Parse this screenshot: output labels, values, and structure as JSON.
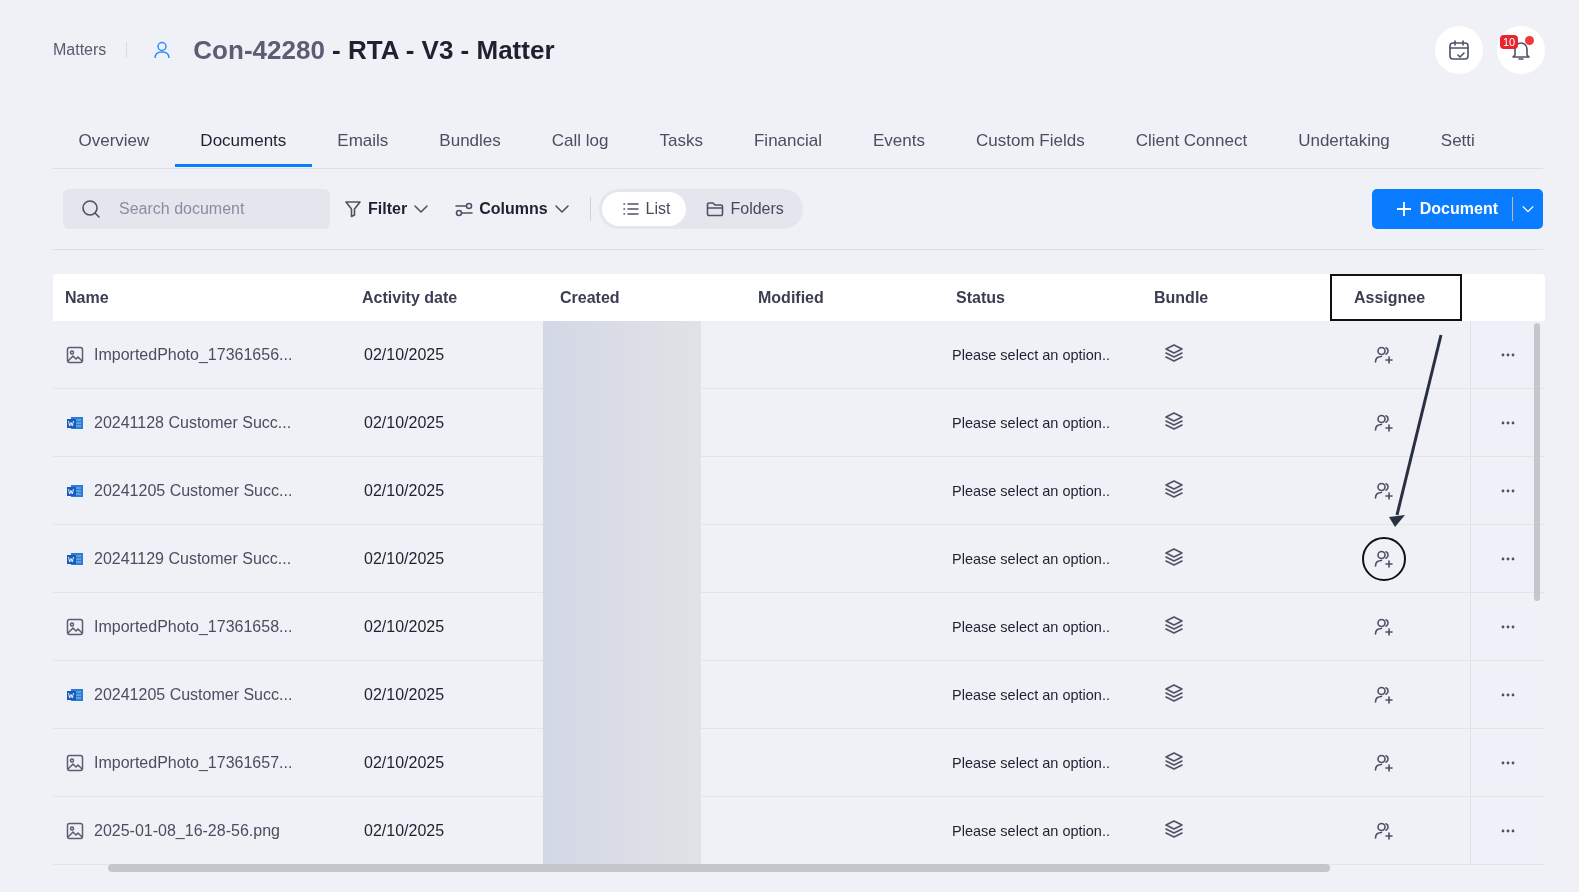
{
  "breadcrumb": "Matters",
  "title": {
    "code": "Con-42280",
    "rest": " - RTA - V3 - Matter"
  },
  "notifications": {
    "count": "10",
    "unread": true
  },
  "tabs": [
    {
      "label": "Overview",
      "selected": false
    },
    {
      "label": "Documents",
      "selected": true
    },
    {
      "label": "Emails",
      "selected": false
    },
    {
      "label": "Bundles",
      "selected": false
    },
    {
      "label": "Call log",
      "selected": false
    },
    {
      "label": "Tasks",
      "selected": false
    },
    {
      "label": "Financial",
      "selected": false
    },
    {
      "label": "Events",
      "selected": false
    },
    {
      "label": "Custom Fields",
      "selected": false
    },
    {
      "label": "Client Connect",
      "selected": false
    },
    {
      "label": "Undertaking",
      "selected": false
    },
    {
      "label": "Setti",
      "selected": false
    }
  ],
  "toolbar": {
    "search": {
      "placeholder": "Search document"
    },
    "filter": "Filter",
    "columns": "Columns",
    "views": [
      {
        "label": "List",
        "kind": "list",
        "selected": true
      },
      {
        "label": "Folders",
        "kind": "folders",
        "selected": false
      }
    ],
    "add_button": "Document"
  },
  "table": {
    "columns": [
      {
        "label": "Name",
        "highlighted": false
      },
      {
        "label": "Activity date",
        "highlighted": false
      },
      {
        "label": "Created",
        "highlighted": false
      },
      {
        "label": "Modified",
        "highlighted": false
      },
      {
        "label": "Status",
        "highlighted": false
      },
      {
        "label": "Bundle",
        "highlighted": false
      },
      {
        "label": "Assignee",
        "highlighted": true
      }
    ],
    "rows": [
      {
        "name": "ImportedPhoto_17361656...",
        "kind": "image",
        "activity_date": "02/10/2025",
        "status": "Please select an option..",
        "highlighted": false
      },
      {
        "name": "20241128 Customer Succ...",
        "kind": "word",
        "activity_date": "02/10/2025",
        "status": "Please select an option..",
        "highlighted": false
      },
      {
        "name": "20241205 Customer Succ...",
        "kind": "word",
        "activity_date": "02/10/2025",
        "status": "Please select an option..",
        "highlighted": false
      },
      {
        "name": "20241129 Customer Succ...",
        "kind": "word",
        "activity_date": "02/10/2025",
        "status": "Please select an option..",
        "highlighted": true
      },
      {
        "name": "ImportedPhoto_17361658...",
        "kind": "image",
        "activity_date": "02/10/2025",
        "status": "Please select an option..",
        "highlighted": false
      },
      {
        "name": "20241205 Customer Succ...",
        "kind": "word",
        "activity_date": "02/10/2025",
        "status": "Please select an option..",
        "highlighted": false
      },
      {
        "name": "ImportedPhoto_17361657...",
        "kind": "image",
        "activity_date": "02/10/2025",
        "status": "Please select an option..",
        "highlighted": false
      },
      {
        "name": "2025-01-08_16-28-56.png",
        "kind": "image",
        "activity_date": "02/10/2025",
        "status": "Please select an option..",
        "highlighted": false
      }
    ]
  }
}
